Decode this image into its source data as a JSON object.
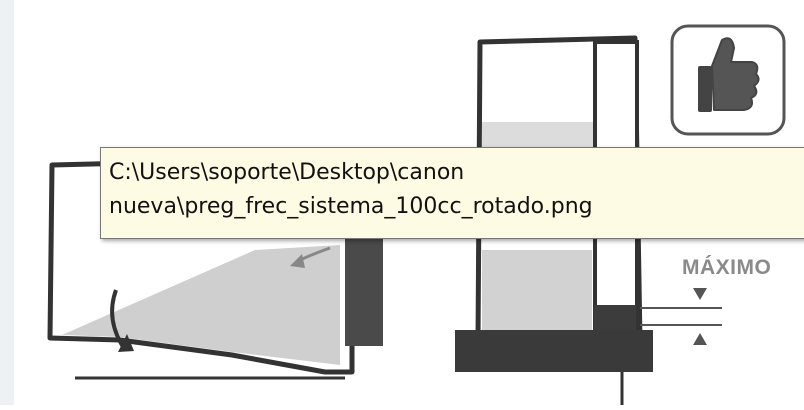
{
  "tooltip": {
    "line1": "C:\\Users\\soporte\\Desktop\\canon",
    "line2": "nueva\\preg_frec_sistema_100cc_rotado.png"
  },
  "illustration": {
    "max_label": "MÁXIMO"
  },
  "icons": {
    "thumbs_up": "thumbs-up-icon"
  },
  "colors": {
    "ink": "#333333",
    "tooltip_bg": "#fdfbe3",
    "grey_fill": "#c8c8c8",
    "dark_base": "#4a4a4a"
  }
}
